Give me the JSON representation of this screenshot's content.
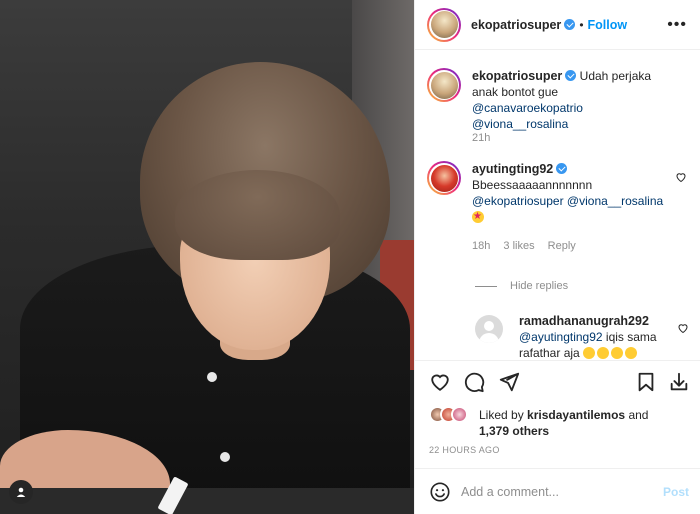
{
  "header": {
    "username": "ekopatriosuper",
    "separator": "•",
    "follow_label": "Follow",
    "more_icon": "more-options-icon"
  },
  "comments": [
    {
      "username": "ekopatriosuper",
      "text": "Udah perjaka anak bontot gue",
      "mentions": [
        "@canavaroekopatrio",
        "@viona__rosalina"
      ],
      "time": "21h"
    },
    {
      "username": "ayutingting92",
      "text": "Bbeessaaaaannnnnnn",
      "mentions": [
        "@ekopatriosuper",
        "@viona__rosalina"
      ],
      "emoji": "star-struck-emoji",
      "time": "18h",
      "likes": "3 likes",
      "reply_label": "Reply"
    }
  ],
  "hide_replies_label": "Hide replies",
  "reply": {
    "username": "ramadhananugrah292",
    "mention": "@ayutingting92",
    "text": "iqis sama rafathar aja"
  },
  "actions": {
    "like_icon": "heart-icon",
    "comment_icon": "comment-icon",
    "share_icon": "send-icon",
    "save_icon": "bookmark-icon",
    "download_icon": "download-icon"
  },
  "likes": {
    "prefix": "Liked by",
    "user": "krisdayantilemos",
    "and": "and",
    "others": "1,379 others"
  },
  "timestamp": "22 HOURS AGO",
  "add_comment": {
    "placeholder": "Add a comment...",
    "post_label": "Post"
  },
  "colors": {
    "accent": "#0095f6",
    "mention": "#00376b",
    "muted": "#8e8e8e",
    "post_disabled": "#b2dffc"
  }
}
